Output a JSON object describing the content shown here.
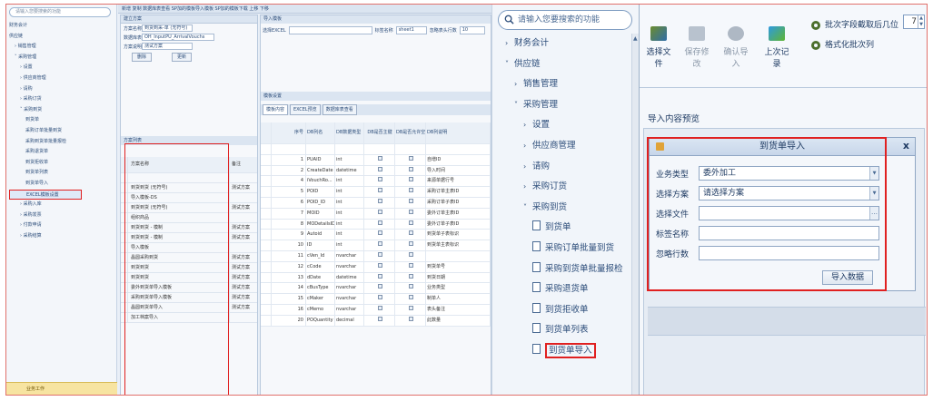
{
  "mini": {
    "search_placeholder": "请输入您要搜索的功能",
    "tree": [
      "财务会计",
      "供应链",
      "› 销售管理",
      "˅ 采购管理",
      "› 设置",
      "› 供应商管理",
      "› 请购",
      "› 采购订货",
      "˅ 采购到货",
      "到货单",
      "采购订单批量到货",
      "采购到货单批量报检",
      "采购退货单",
      "到货拒收单",
      "到货单列表",
      "到货单导入",
      "EXCEL模板设置",
      "› 采购入库",
      "› 采购发票",
      "› 付款申请",
      "› 采购结算"
    ],
    "tree_selected_index": 16,
    "footer": "业务工作",
    "toolbar": "新增  复制  数据库表查看  SP加的模板导入模板  SP加的模板下载  上移  下移",
    "p2": {
      "header": "建立方案",
      "rows": [
        {
          "label": "方案名称",
          "value": "到货到采-单 (无符号)"
        },
        {
          "label": "数据库表",
          "value": "OH_InputPU_ArrivalVouchs"
        },
        {
          "label": "方案说明",
          "value": "测试方案"
        }
      ],
      "delete": "删除",
      "update": "更新",
      "sub": "方案列表",
      "col_name": "方案名称",
      "col_note": "备注",
      "items": [
        {
          "name": "到货到货 (无符号)",
          "note": "测试方案"
        },
        {
          "name": "导入模板-DS",
          "note": ""
        },
        {
          "name": "到货到货 (无符号)",
          "note": "测试方案"
        },
        {
          "name": "组织商品",
          "note": ""
        },
        {
          "name": "到货到货 - 模制",
          "note": "测试方案"
        },
        {
          "name": "到货到货 - 模制",
          "note": "测试方案"
        },
        {
          "name": "导入模板",
          "note": ""
        },
        {
          "name": "晶圆采购到货",
          "note": "测试方案"
        },
        {
          "name": "到货到货",
          "note": "测试方案"
        },
        {
          "name": "到货到货",
          "note": "测试方案"
        },
        {
          "name": "委外到货单导入模板",
          "note": "测试方案"
        },
        {
          "name": "采购到货单导入模板",
          "note": "测试方案"
        },
        {
          "name": "晶圆到货单导入",
          "note": "测试方案"
        },
        {
          "name": "加工档案导入",
          "note": ""
        }
      ]
    },
    "p3": {
      "header": "导入模板",
      "excel_label": "选择EXCEL",
      "sheet_label": "标签名称",
      "sheet_value": "sheet1",
      "skip_label": "忽略表头行数",
      "skip_value": "10",
      "sub": "模板设置",
      "tabs": [
        "模板内容",
        "EXCEL预览",
        "数据库表查看"
      ],
      "cols": [
        "序号",
        "DB列名",
        "DB数据类型",
        "DB是否主键",
        "DB是否允许空",
        "DB列说明"
      ],
      "rows": [
        {
          "n": "1",
          "col": "PUAID",
          "type": "int",
          "note": "自增ID"
        },
        {
          "n": "2",
          "col": "CreateDate",
          "type": "datetime",
          "note": "导入时间"
        },
        {
          "n": "4",
          "col": "iVouchRo...",
          "type": "int",
          "note": "来源单据行号"
        },
        {
          "n": "5",
          "col": "POID",
          "type": "int",
          "note": "采购订单主表ID"
        },
        {
          "n": "6",
          "col": "POID_ID",
          "type": "int",
          "note": "采购订单子表ID"
        },
        {
          "n": "7",
          "col": "MOID",
          "type": "int",
          "note": "委外订单主表ID"
        },
        {
          "n": "8",
          "col": "MODetailsID",
          "type": "int",
          "note": "委外订单子表ID"
        },
        {
          "n": "9",
          "col": "Autoid",
          "type": "int",
          "note": "到货单子表标识"
        },
        {
          "n": "10",
          "col": "ID",
          "type": "int",
          "note": "到货单主表标识"
        },
        {
          "n": "11",
          "col": "cVen_Id",
          "type": "nvarchar",
          "note": ""
        },
        {
          "n": "12",
          "col": "cCode",
          "type": "nvarchar",
          "note": "到货单号"
        },
        {
          "n": "13",
          "col": "dDate",
          "type": "datetime",
          "note": "到货日期"
        },
        {
          "n": "14",
          "col": "cBusType",
          "type": "nvarchar",
          "note": "业务类型"
        },
        {
          "n": "15",
          "col": "cMaker",
          "type": "nvarchar",
          "note": "制单人"
        },
        {
          "n": "16",
          "col": "cMemo",
          "type": "nvarchar",
          "note": "表头备注"
        },
        {
          "n": "20",
          "col": "POQuantity",
          "type": "decimal",
          "note": "此数量"
        }
      ]
    }
  },
  "nav": {
    "search_placeholder": "请输入您要搜索的功能",
    "items": [
      {
        "arrow": "›",
        "label": "财务会计",
        "indent": 0,
        "doc": false
      },
      {
        "arrow": "˅",
        "label": "供应链",
        "indent": 0,
        "doc": false
      },
      {
        "arrow": "›",
        "label": "销售管理",
        "indent": 1,
        "doc": false
      },
      {
        "arrow": "˅",
        "label": "采购管理",
        "indent": 1,
        "doc": false
      },
      {
        "arrow": "›",
        "label": "设置",
        "indent": 2,
        "doc": false
      },
      {
        "arrow": "›",
        "label": "供应商管理",
        "indent": 2,
        "doc": false
      },
      {
        "arrow": "›",
        "label": "请购",
        "indent": 2,
        "doc": false
      },
      {
        "arrow": "›",
        "label": "采购订货",
        "indent": 2,
        "doc": false
      },
      {
        "arrow": "˅",
        "label": "采购到货",
        "indent": 2,
        "doc": false
      },
      {
        "arrow": "",
        "label": "到货单",
        "indent": 3,
        "doc": true
      },
      {
        "arrow": "",
        "label": "采购订单批量到货",
        "indent": 3,
        "doc": true
      },
      {
        "arrow": "",
        "label": "采购到货单批量报检",
        "indent": 3,
        "doc": true
      },
      {
        "arrow": "",
        "label": "采购退货单",
        "indent": 3,
        "doc": true
      },
      {
        "arrow": "",
        "label": "到货拒收单",
        "indent": 3,
        "doc": true
      },
      {
        "arrow": "",
        "label": "到货单列表",
        "indent": 3,
        "doc": true
      },
      {
        "arrow": "",
        "label": "到货单导入",
        "indent": 3,
        "doc": true,
        "selected": true
      }
    ]
  },
  "right": {
    "toolbar": [
      {
        "label": "选择文件",
        "icon": "folder-icon",
        "disabled": false
      },
      {
        "label": "保存修改",
        "icon": "save-icon",
        "disabled": true
      },
      {
        "label": "确认导入",
        "icon": "import-icon",
        "disabled": true
      },
      {
        "label": "上次记录",
        "icon": "history-icon",
        "disabled": false
      }
    ],
    "batch_label": "批次字段截取后几位",
    "batch_value": "7",
    "format_label": "格式化批次列",
    "preview_label": "导入内容预览",
    "dialog": {
      "title": "到货单导入",
      "close": "x",
      "fields": [
        {
          "label": "业务类型",
          "value": "委外加工",
          "dropdown": true
        },
        {
          "label": "选择方案",
          "value": "请选择方案",
          "dropdown": true
        },
        {
          "label": "选择文件",
          "value": "",
          "browse": true
        },
        {
          "label": "标签名称",
          "value": ""
        },
        {
          "label": "忽略行数",
          "value": ""
        }
      ],
      "import_button": "导入数据"
    }
  }
}
